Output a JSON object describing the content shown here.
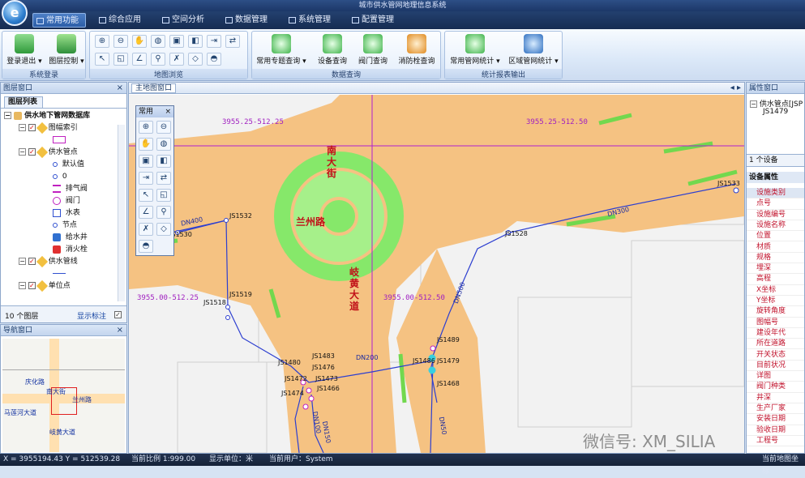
{
  "window": {
    "title": "城市供水管网地理信息系统"
  },
  "menus": [
    {
      "label": "常用功能",
      "active": true
    },
    {
      "label": "综合应用"
    },
    {
      "label": "空间分析"
    },
    {
      "label": "数据管理"
    },
    {
      "label": "系统管理"
    },
    {
      "label": "配置管理"
    }
  ],
  "ribbon": {
    "groups": [
      {
        "label": "系统登录",
        "buttons": [
          "登录退出 ▾",
          "图层控制 ▾"
        ]
      },
      {
        "label": "地图浏览"
      },
      {
        "label": "数据查询",
        "buttons": [
          "常用专题查询 ▾",
          "设备查询",
          "阀门查询",
          "消防栓查询"
        ]
      },
      {
        "label": "统计报表输出",
        "buttons": [
          "常用管网统计 ▾",
          "区域管网统计 ▾"
        ]
      }
    ]
  },
  "layer_panel": {
    "title": "图层窗口",
    "tab": "图层列表",
    "root": "供水地下管网数据库",
    "items": [
      "图幅索引",
      "供水管点",
      "默认值",
      "0",
      "排气阀",
      "阀门",
      "水表",
      "节点",
      "给水井",
      "消火栓",
      "供水管线",
      "单位点"
    ],
    "count": "10 个图层",
    "show_label": "显示标注"
  },
  "nav_panel": {
    "title": "导航窗口",
    "labels": [
      "庆化路",
      "南大街",
      "兰州路",
      "马莲河大道",
      "岐黄大道"
    ]
  },
  "map_panel": {
    "title": "主地图窗口",
    "toolbox_title": "常用",
    "coords": [
      "3955.25-512.25",
      "3955.25-512.50",
      "3955.00-512.25",
      "3955.00-512.50"
    ],
    "roads": [
      "南大街",
      "兰州路",
      "岐黄大道"
    ],
    "pipes": [
      "DN300",
      "DN400",
      "DN200",
      "DN100",
      "DN150",
      "DN50",
      "DN500"
    ],
    "nodes": [
      "JS1532",
      "JS1530",
      "JS1519",
      "JS1518",
      "JS1528",
      "JS1533",
      "JS1489",
      "JS1483",
      "JS1480",
      "JS1476",
      "JS1472",
      "JS1473",
      "JS1474",
      "JS1466",
      "JS1486",
      "JS1479",
      "JS1468"
    ],
    "watermark": "微信号: XM_SILIA"
  },
  "attr_panel": {
    "title": "属性窗口",
    "tree_root": "供水管点[JSP",
    "tree_child": "JS1479",
    "count": "1 个设备",
    "section": "设备属性",
    "props": [
      "设施类别",
      "点号",
      "设施编号",
      "设施名称",
      "位置",
      "材质",
      "规格",
      "埋深",
      "高程",
      "X坐标",
      "Y坐标",
      "旋转角度",
      "图幅号",
      "建设年代",
      "所在道路",
      "开关状态",
      "目前状况",
      "详图",
      "阀门种类",
      "井深",
      "生产厂家",
      "安装日期",
      "验收日期",
      "工程号"
    ]
  },
  "status": {
    "coord": "X = 3955194.43  Y = 512539.28",
    "scale": "当前比例 1:999.00",
    "unit": "显示单位：米",
    "user": "当前用户：System",
    "right": "当前地图坐标"
  },
  "colors": {
    "road": "#f5c282",
    "green": "#80e860",
    "pipe": "#2d3fd0",
    "grid": "#b020d0",
    "background": "#f2f2f2"
  }
}
